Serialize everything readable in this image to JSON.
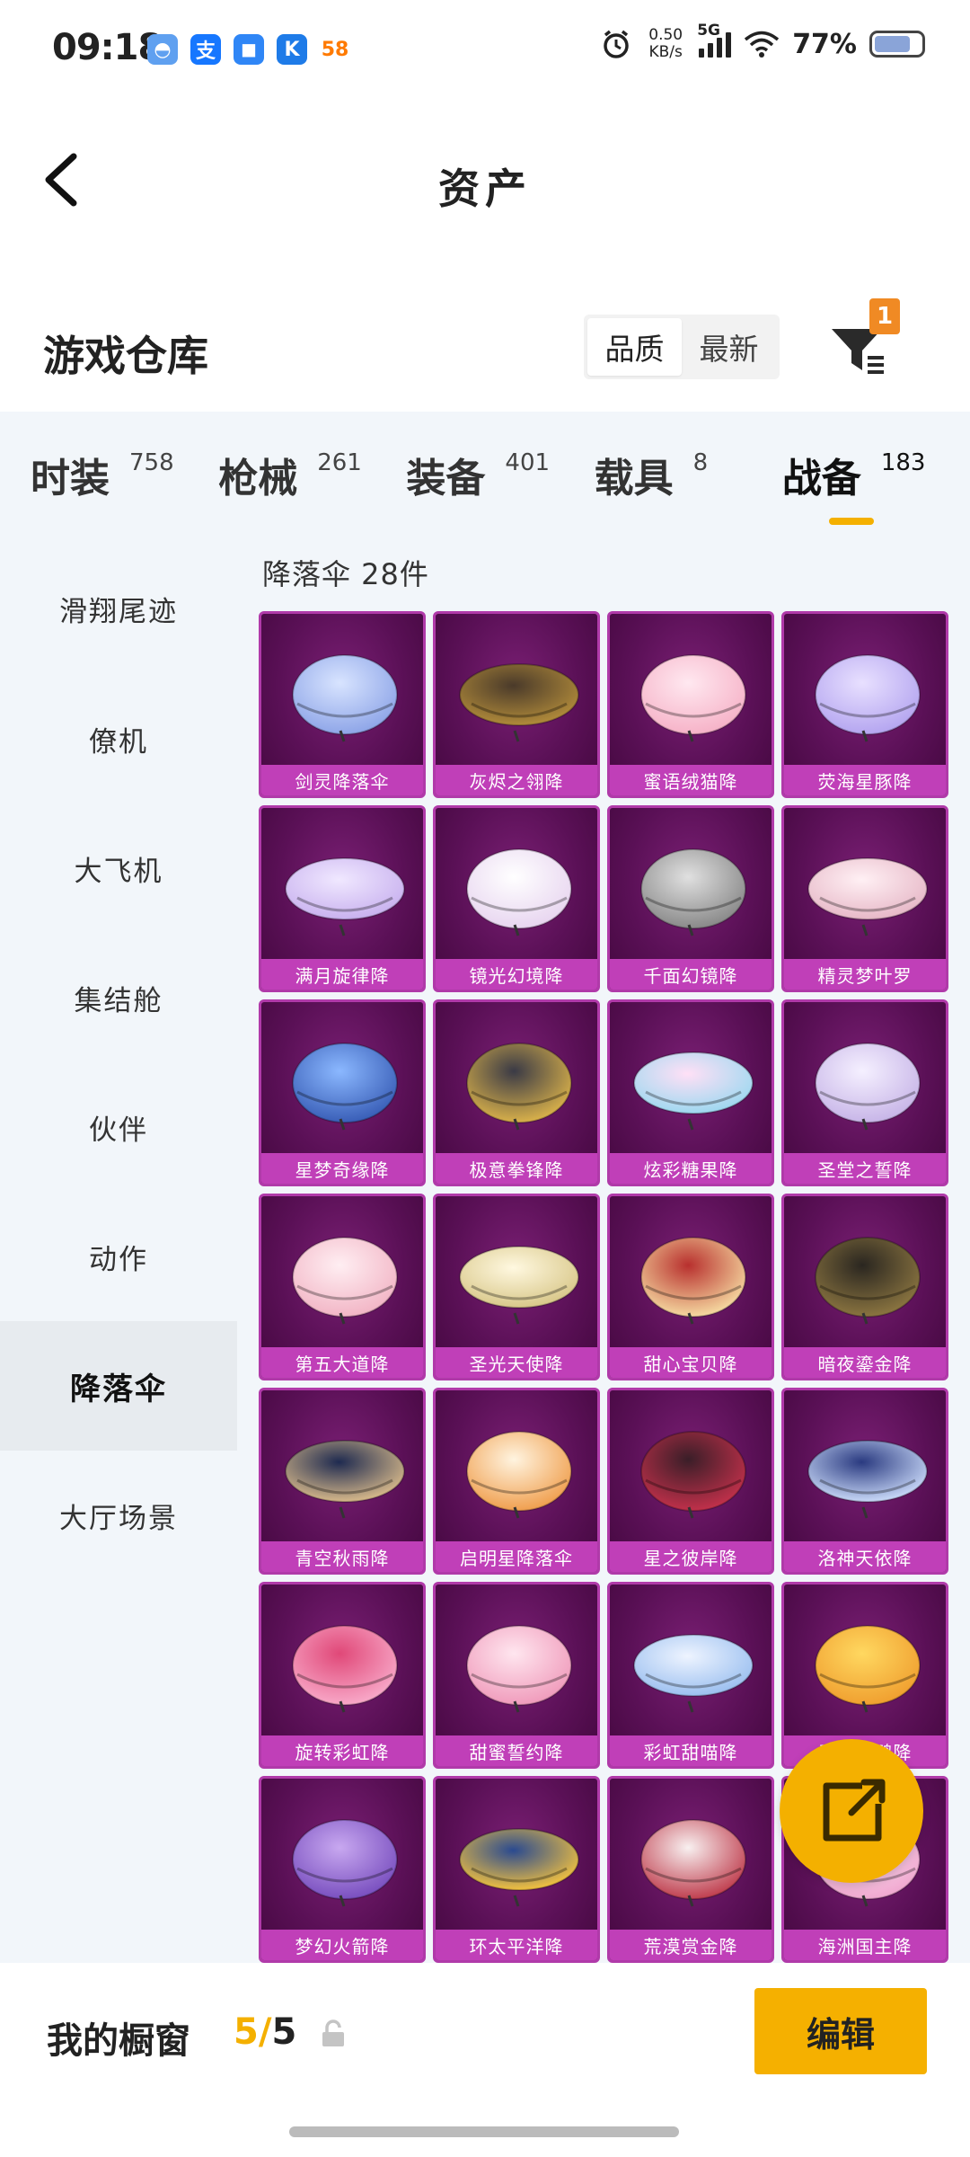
{
  "status_bar": {
    "time": "09:18",
    "net_rate_value": "0.50",
    "net_rate_unit": "KB/s",
    "network": "5G",
    "battery": "77%",
    "battery_level": 0.77,
    "app_icons": [
      {
        "name": "cloud-app-icon",
        "glyph": "◓",
        "color": "#5fa0f0"
      },
      {
        "name": "alipay-app-icon",
        "glyph": "支",
        "color": "#1677ff"
      },
      {
        "name": "chat-app-icon",
        "glyph": "◼",
        "color": "#2f86f6"
      },
      {
        "name": "k-app-icon",
        "glyph": "K",
        "color": "#1e7be8"
      },
      {
        "name": "58-app-icon",
        "glyph": "58",
        "color": "#ff7a00"
      }
    ]
  },
  "nav": {
    "title": "资产"
  },
  "warehouse": {
    "title": "游戏仓库",
    "sort_options": [
      "品质",
      "最新"
    ],
    "filter_badge": "1"
  },
  "tabs": [
    {
      "label": "时装",
      "count": "758"
    },
    {
      "label": "枪械",
      "count": "261"
    },
    {
      "label": "装备",
      "count": "401"
    },
    {
      "label": "载具",
      "count": "8"
    },
    {
      "label": "战备",
      "count": "183"
    }
  ],
  "sidebar": [
    "滑翔尾迹",
    "僚机",
    "大飞机",
    "集结舱",
    "伙伴",
    "动作",
    "降落伞",
    "大厅场景"
  ],
  "content": {
    "subheader": "降落伞 28件",
    "items": [
      {
        "label": "剑灵降落伞",
        "c1": "#d8e4ff",
        "c2": "#8fa6e8"
      },
      {
        "label": "灰烬之翎降",
        "c1": "#4a3a2a",
        "c2": "#b08a3a"
      },
      {
        "label": "蜜语绒猫降",
        "c1": "#ffe8f0",
        "c2": "#f6b3c8"
      },
      {
        "label": "荧海星豚降",
        "c1": "#e8e0ff",
        "c2": "#b5a6f0"
      },
      {
        "label": "满月旋律降",
        "c1": "#f0e8ff",
        "c2": "#c9b2ef"
      },
      {
        "label": "镜光幻境降",
        "c1": "#ffffff",
        "c2": "#e8d6f0"
      },
      {
        "label": "千面幻镜降",
        "c1": "#e0e0e0",
        "c2": "#8a8a8a"
      },
      {
        "label": "精灵梦叶罗",
        "c1": "#fff0f4",
        "c2": "#e7b9c8"
      },
      {
        "label": "星梦奇缘降",
        "c1": "#8bb8ff",
        "c2": "#3a5fb8"
      },
      {
        "label": "极意拳锋降",
        "c1": "#3a3a46",
        "c2": "#d8b04a"
      },
      {
        "label": "炫彩糖果降",
        "c1": "#ffe0f6",
        "c2": "#9fd8f0"
      },
      {
        "label": "圣堂之誓降",
        "c1": "#f5f0ff",
        "c2": "#c8b6e8"
      },
      {
        "label": "第五大道降",
        "c1": "#ffeef2",
        "c2": "#f2b6c6"
      },
      {
        "label": "圣光天使降",
        "c1": "#fff8e0",
        "c2": "#d9c88a"
      },
      {
        "label": "甜心宝贝降",
        "c1": "#b8302e",
        "c2": "#f5d8a0"
      },
      {
        "label": "暗夜鎏金降",
        "c1": "#2a2620",
        "c2": "#8a7440"
      },
      {
        "label": "青空秋雨降",
        "c1": "#1e2a50",
        "c2": "#d6b88a"
      },
      {
        "label": "启明星降落伞",
        "c1": "#fff4e0",
        "c2": "#f0a050"
      },
      {
        "label": "星之彼岸降",
        "c1": "#3a1e28",
        "c2": "#c0304a"
      },
      {
        "label": "洛神天依降",
        "c1": "#2a3a80",
        "c2": "#c8d8f8"
      },
      {
        "label": "旋转彩虹降",
        "c1": "#e04878",
        "c2": "#f8a8c8"
      },
      {
        "label": "甜蜜誓约降",
        "c1": "#ffe6ef",
        "c2": "#f09cbc"
      },
      {
        "label": "彩虹甜喵降",
        "c1": "#eef4ff",
        "c2": "#9cc0f0"
      },
      {
        "label": "乘风小鸭降",
        "c1": "#ffd860",
        "c2": "#f0a030"
      },
      {
        "label": "梦幻火箭降",
        "c1": "#c8a8f0",
        "c2": "#7a50c0"
      },
      {
        "label": "环太平洋降",
        "c1": "#2a4a90",
        "c2": "#f0c040"
      },
      {
        "label": "荒漠赏金降",
        "c1": "#f8f0f0",
        "c2": "#c04050"
      },
      {
        "label": "海洲国主降",
        "c1": "#ffe8f4",
        "c2": "#f0a8d0"
      }
    ]
  },
  "bottom": {
    "title": "我的橱窗",
    "count_used": "5",
    "count_sep": "/",
    "count_total": "5",
    "edit_label": "编辑"
  }
}
